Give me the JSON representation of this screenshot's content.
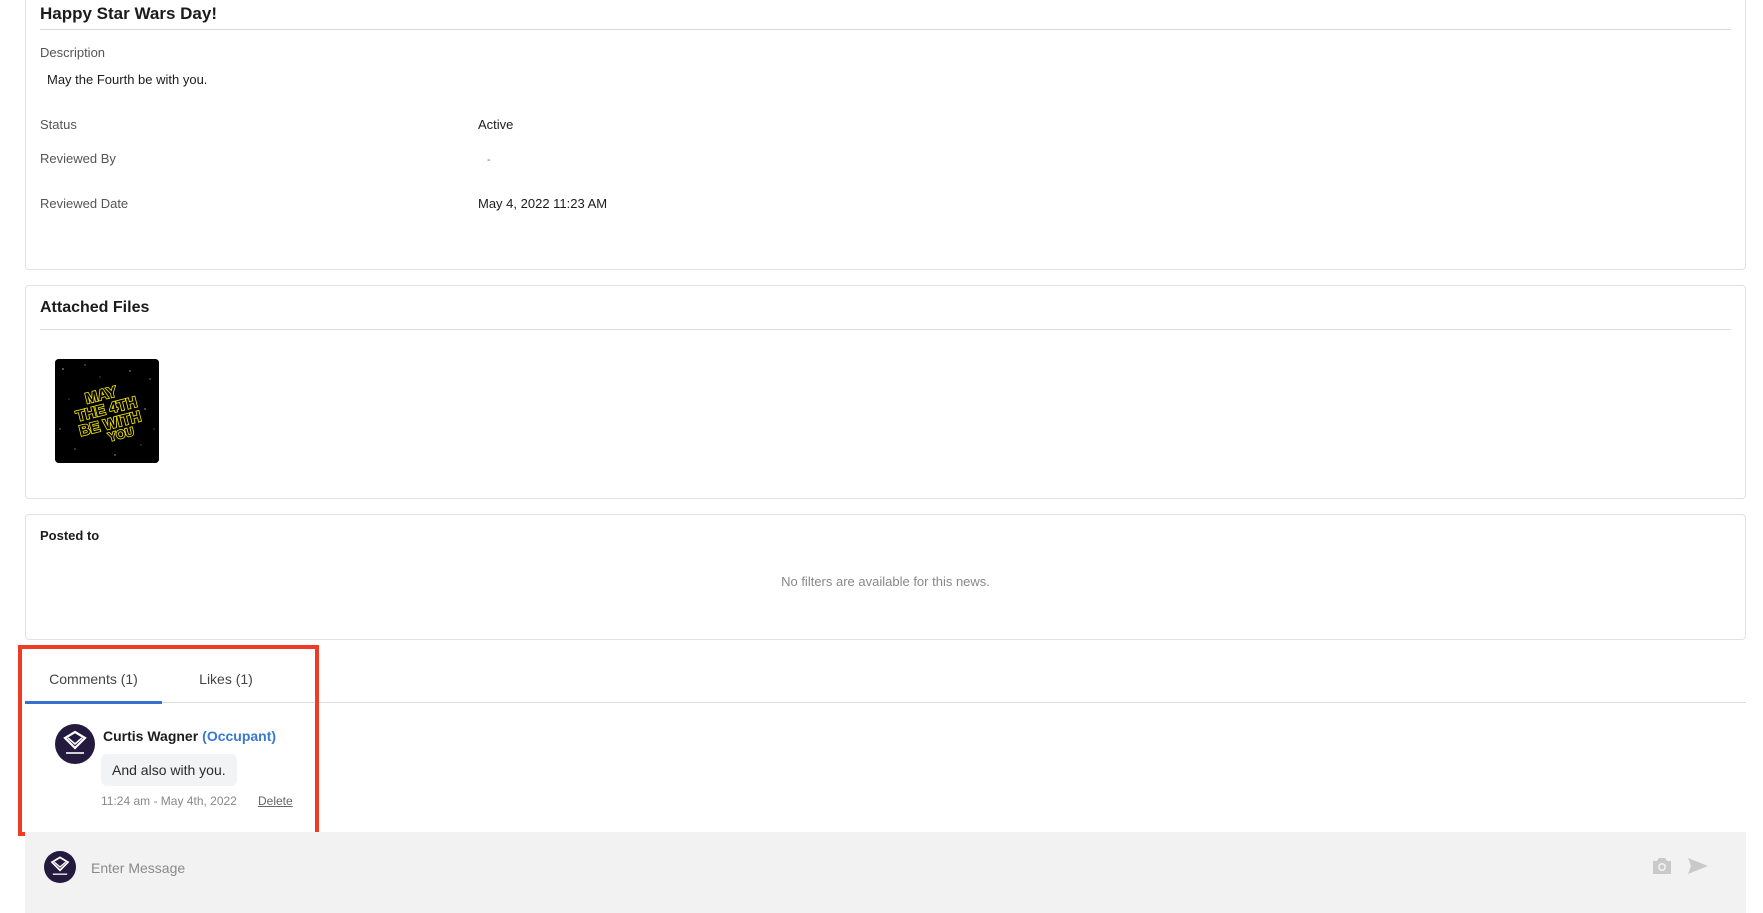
{
  "news": {
    "title": "Happy Star Wars Day!",
    "description_label": "Description",
    "description": "May the Fourth be with you.",
    "status_label": "Status",
    "status": "Active",
    "reviewed_by_label": "Reviewed By",
    "reviewed_by": "-",
    "reviewed_date_label": "Reviewed Date",
    "reviewed_date": "May 4, 2022 11:23 AM"
  },
  "attached_files": {
    "title": "Attached Files",
    "thumbnail_text": [
      "MAY",
      "THE 4TH",
      "BE WITH",
      "YOU"
    ]
  },
  "posted_to": {
    "title": "Posted to",
    "empty_message": "No filters are available for this news."
  },
  "tabs": [
    {
      "label": "Comments (1)",
      "active": true
    },
    {
      "label": "Likes (1)",
      "active": false
    }
  ],
  "comments": [
    {
      "author": "Curtis Wagner",
      "role": "(Occupant)",
      "text": "And also with you.",
      "timestamp": "11:24 am - May 4th, 2022",
      "delete_label": "Delete"
    }
  ],
  "composer": {
    "placeholder": "Enter Message",
    "camera_icon": "camera-icon",
    "send_icon": "send-icon"
  },
  "colors": {
    "accent": "#3a78d0",
    "highlight": "#ef3b24",
    "avatar_bg": "#231a3d",
    "thumb_text": "#f4e60c"
  }
}
